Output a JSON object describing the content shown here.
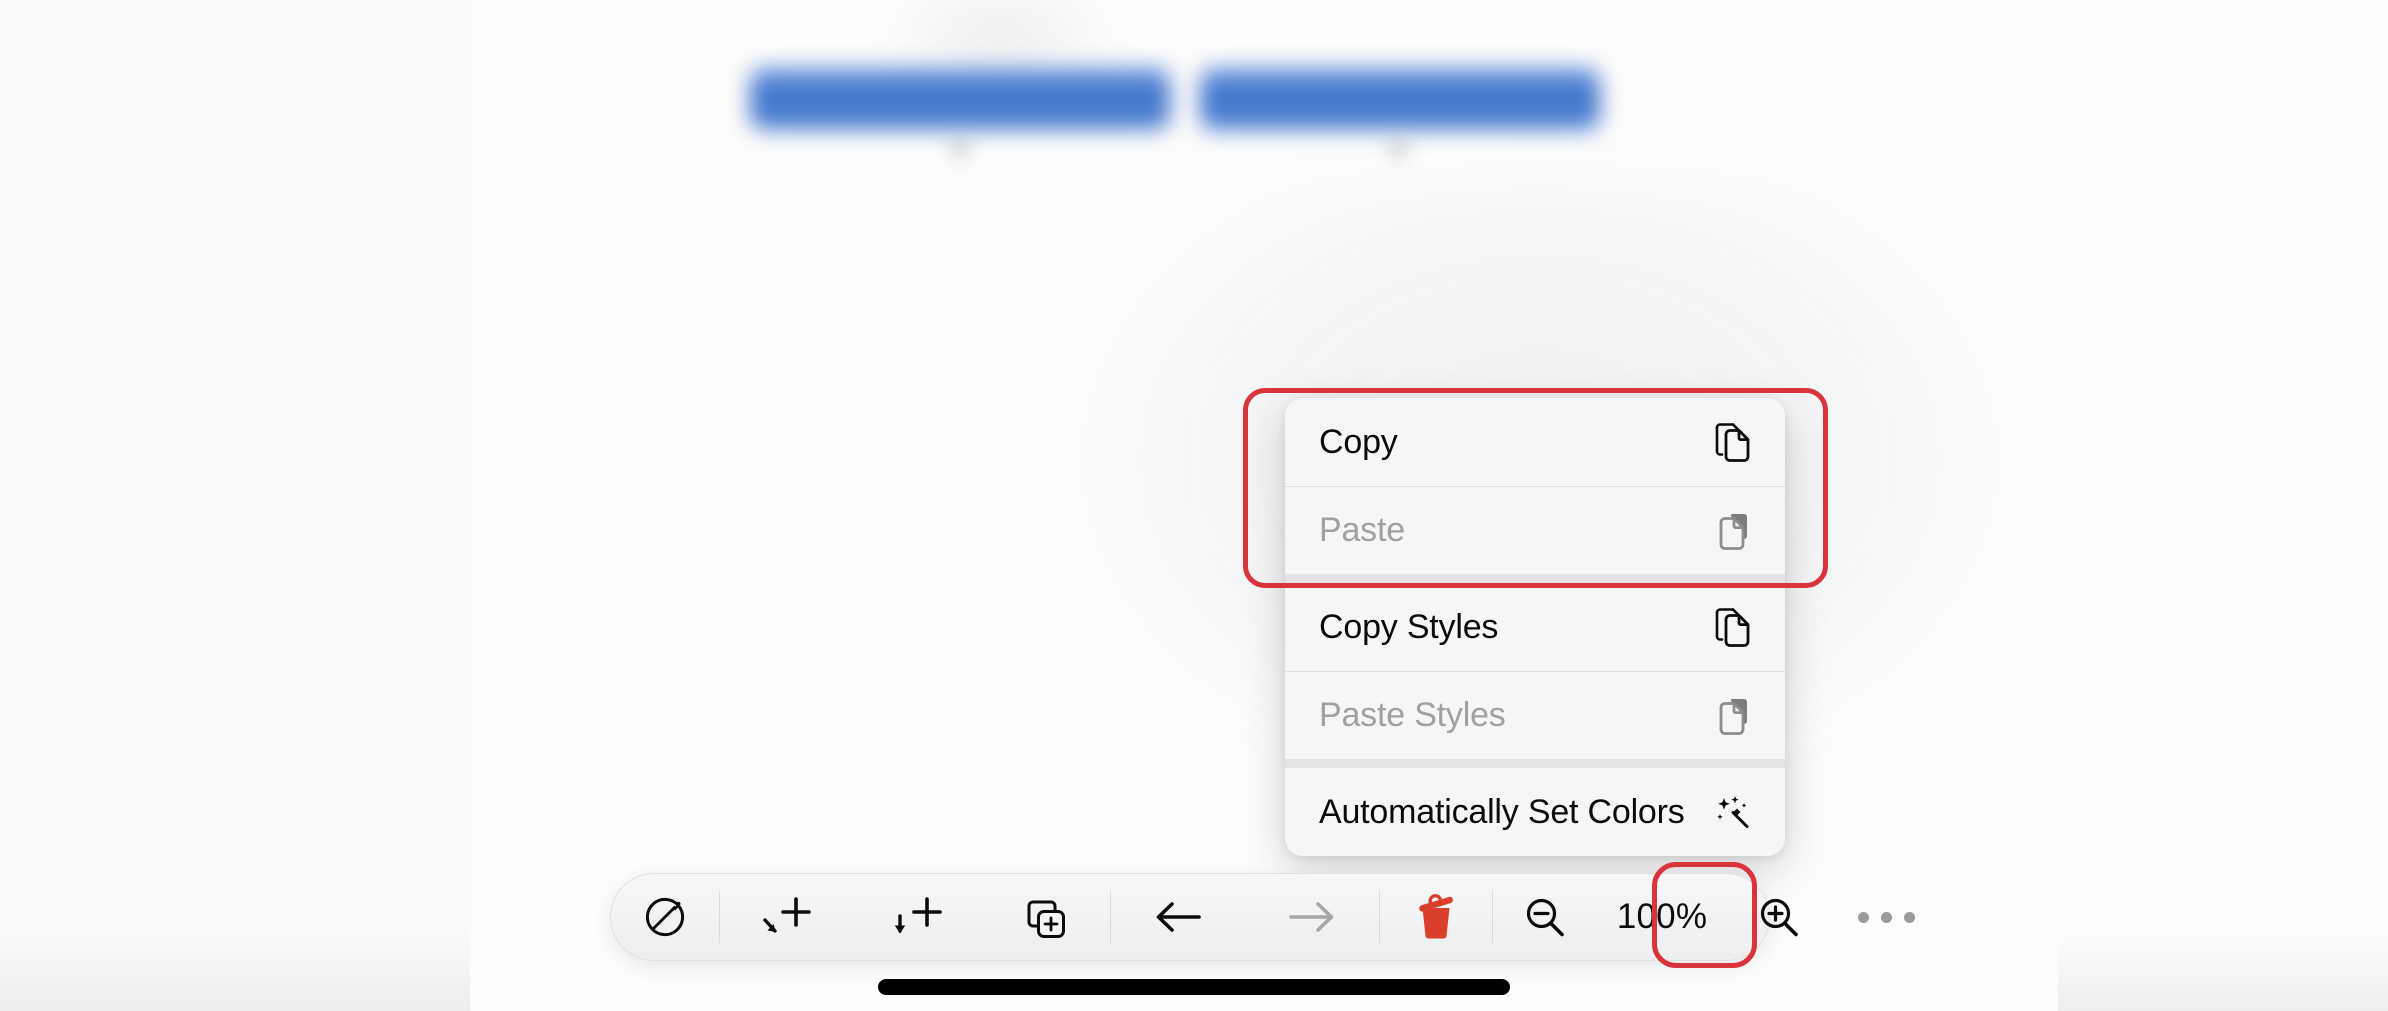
{
  "app": {
    "surface": "mindmap-canvas",
    "home_indicator": true
  },
  "canvas": {
    "nodes": [
      {
        "id": "node-1",
        "label_redacted": true,
        "color": "#3f73c9"
      },
      {
        "id": "node-2",
        "label_redacted": true,
        "color": "#3f73c9"
      }
    ]
  },
  "context_menu": {
    "groups": [
      {
        "name": "clipboard",
        "highlighted": true,
        "items": [
          {
            "label": "Copy",
            "icon": "copy-icon",
            "enabled": true
          },
          {
            "label": "Paste",
            "icon": "paste-icon",
            "enabled": false
          }
        ]
      },
      {
        "name": "styles",
        "highlighted": false,
        "items": [
          {
            "label": "Copy Styles",
            "icon": "copy-icon",
            "enabled": true
          },
          {
            "label": "Paste Styles",
            "icon": "paste-icon",
            "enabled": false
          }
        ]
      },
      {
        "name": "colors",
        "highlighted": false,
        "items": [
          {
            "label": "Automatically Set Colors",
            "icon": "magic-wand-icon",
            "enabled": true
          }
        ]
      }
    ]
  },
  "toolbar": {
    "buttons": [
      {
        "name": "focus-mode-button",
        "icon": "circle-pen-icon",
        "enabled": true
      },
      {
        "name": "add-sibling-button",
        "icon": "arrow-branch-plus-icon",
        "enabled": true
      },
      {
        "name": "add-child-button",
        "icon": "arrow-down-plus-icon",
        "enabled": true
      },
      {
        "name": "duplicate-button",
        "icon": "duplicate-plus-icon",
        "enabled": true
      },
      {
        "name": "undo-button",
        "icon": "arrow-left-icon",
        "enabled": true
      },
      {
        "name": "redo-button",
        "icon": "arrow-right-icon",
        "enabled": false
      },
      {
        "name": "delete-button",
        "icon": "trash-icon",
        "enabled": true
      },
      {
        "name": "zoom-out-button",
        "icon": "magnifier-minus-icon",
        "enabled": true
      },
      {
        "name": "zoom-in-button",
        "icon": "magnifier-plus-icon",
        "enabled": true
      },
      {
        "name": "more-options-button",
        "icon": "ellipsis-icon",
        "enabled": true
      }
    ],
    "zoom_level": "100%"
  },
  "annotations": {
    "accent_color": "#d8343a",
    "boxes": [
      {
        "name": "highlight-copy-paste-group",
        "target": "clipboard-group"
      },
      {
        "name": "highlight-more-button",
        "target": "more-options-button"
      }
    ]
  }
}
